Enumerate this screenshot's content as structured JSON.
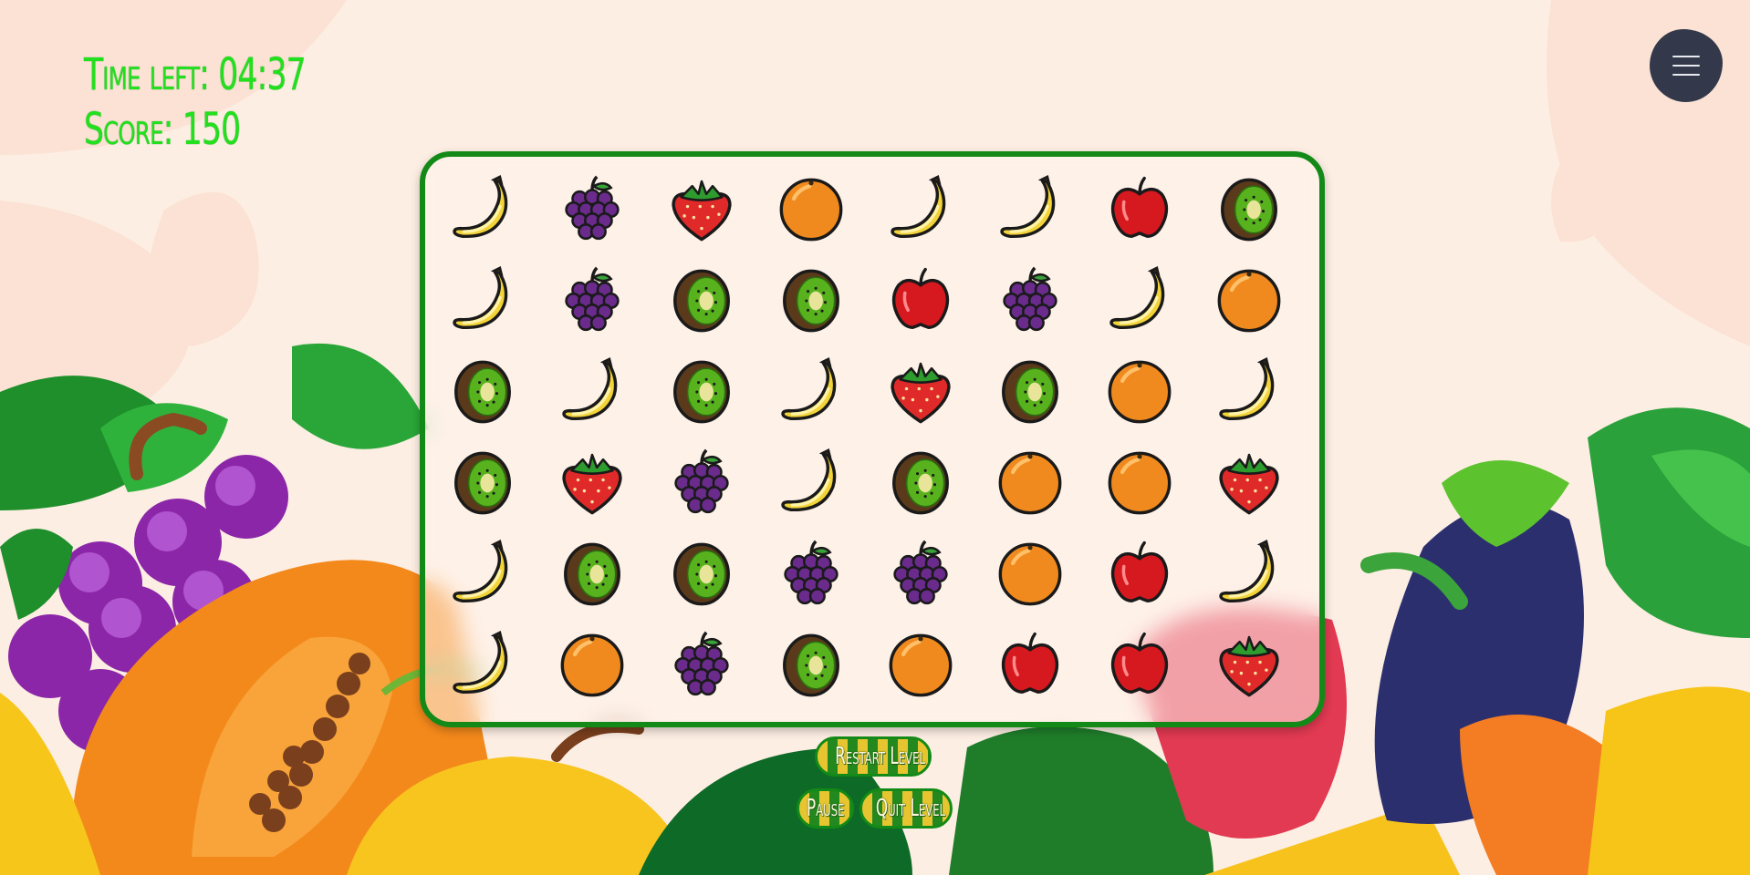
{
  "hud": {
    "time_label": "Time left:",
    "time_value": "04:37",
    "score_label": "Score:",
    "score_value": "150"
  },
  "colors": {
    "hud_text": "#22e01e",
    "board_border": "#138a17",
    "menu_button": "#33394a",
    "background": "#fdeee3"
  },
  "menu": {
    "icon": "hamburger-menu-icon"
  },
  "board": {
    "columns": 8,
    "rows": 6,
    "tiles": [
      [
        "banana",
        "grapes",
        "strawberry",
        "orange",
        "banana",
        "banana",
        "apple",
        "kiwi"
      ],
      [
        "banana",
        "grapes",
        "kiwi",
        "kiwi",
        "apple",
        "grapes",
        "banana",
        "orange"
      ],
      [
        "kiwi",
        "banana",
        "kiwi",
        "banana",
        "strawberry",
        "kiwi",
        "orange",
        "banana"
      ],
      [
        "kiwi",
        "strawberry",
        "grapes",
        "banana",
        "kiwi",
        "orange",
        "orange",
        "strawberry"
      ],
      [
        "banana",
        "kiwi",
        "kiwi",
        "grapes",
        "grapes",
        "orange",
        "apple",
        "banana"
      ],
      [
        "banana",
        "orange",
        "grapes",
        "kiwi",
        "orange",
        "apple",
        "apple",
        "strawberry"
      ]
    ]
  },
  "buttons": {
    "restart": "Restart Level",
    "pause": "Pause",
    "quit": "Quit Level"
  }
}
